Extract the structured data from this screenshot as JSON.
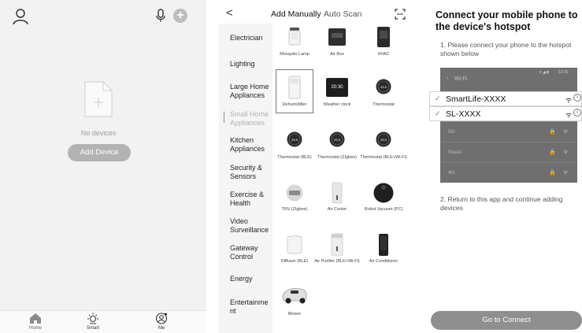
{
  "home": {
    "empty_text": "No devices",
    "add_device_label": "Add Device",
    "tabs": [
      {
        "label": "Home",
        "icon": "home-icon"
      },
      {
        "label": "Smart",
        "icon": "sun-icon"
      },
      {
        "label": "Me",
        "icon": "me-icon"
      }
    ]
  },
  "catalog": {
    "back_glyph": "<",
    "tabs": [
      {
        "label": "Add Manually",
        "active": true
      },
      {
        "label": "Auto Scan",
        "active": false
      }
    ],
    "categories": [
      {
        "label": "Electrician"
      },
      {
        "label": "Lighting"
      },
      {
        "label": "Large Home Appliances"
      },
      {
        "label": "Small Home Appliances",
        "selected": true
      },
      {
        "label": "Kitchen Appliances"
      },
      {
        "label": "Security & Sensors"
      },
      {
        "label": "Exercise & Health"
      },
      {
        "label": "Video Surveillance"
      },
      {
        "label": "Gateway Control"
      },
      {
        "label": "Energy"
      },
      {
        "label": "Entertainme nt"
      }
    ],
    "products": [
      {
        "label": "Mosquito Lamp"
      },
      {
        "label": "Air Box"
      },
      {
        "label": "HVAC"
      },
      {
        "label": "Dehumidifier",
        "selected": true
      },
      {
        "label": "Weather clock",
        "display": "20:30"
      },
      {
        "label": "Thermostat",
        "display": "25.5"
      },
      {
        "label": "Thermostat (BLE)",
        "display": "25.5"
      },
      {
        "label": "Thermostat (Zigbee)",
        "display": "25.5"
      },
      {
        "label": "Thermostat (BLE+Wi-Fi)",
        "display": "25.5"
      },
      {
        "label": "TRV (Zigbee)"
      },
      {
        "label": "Air Cooler"
      },
      {
        "label": "Robot Vacuum (PC)"
      },
      {
        "label": "Diffuser (BLE)"
      },
      {
        "label": "Air Purifier (BLE+Wi-Fi)"
      },
      {
        "label": "Air Conditioner"
      },
      {
        "label": "Mower"
      }
    ]
  },
  "hotspot": {
    "title": "Connect your mobile phone to the device's hotspot",
    "step1": "1. Please connect your phone to the hotspot shown below",
    "wifi_header": "Wi-Fi",
    "status_time": "12:30",
    "highlighted": [
      {
        "name": "SmartLife-XXXX"
      },
      {
        "name": "SL-XXXX"
      }
    ],
    "other_networks": [
      {
        "name": "5G"
      },
      {
        "name": "Guest"
      },
      {
        "name": "4G"
      }
    ],
    "step2": "2. Return to this app and continue adding devices",
    "connect_label": "Go to Connect"
  },
  "colors": {
    "button_gray": "#b3b3b3",
    "connect_gray": "#8f8f8f",
    "wifi_panel": "#6f6f6f"
  }
}
